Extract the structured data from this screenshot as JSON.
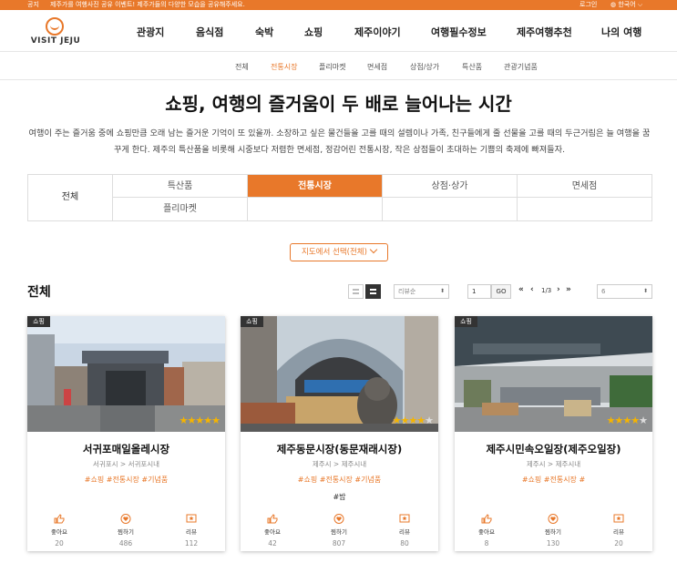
{
  "notice": {
    "label": "공지",
    "message": "제주가를 여행사진 공유 이벤트! 제주가들의 다양한 모습을 공유해주세요.",
    "login": "로그인",
    "language": "한국어"
  },
  "brand": {
    "logo_text": "VISIT JEJU",
    "accent": "#e8782a"
  },
  "gnb": [
    {
      "label": "관광지"
    },
    {
      "label": "음식점"
    },
    {
      "label": "숙박"
    },
    {
      "label": "쇼핑"
    },
    {
      "label": "제주이야기"
    },
    {
      "label": "여행필수정보"
    },
    {
      "label": "제주여행추천"
    },
    {
      "label": "나의 여행"
    }
  ],
  "subnav": [
    {
      "label": "전체"
    },
    {
      "label": "전통시장"
    },
    {
      "label": "플리마켓"
    },
    {
      "label": "면세점"
    },
    {
      "label": "상점/상가"
    },
    {
      "label": "특산품"
    },
    {
      "label": "관광기념품"
    }
  ],
  "hero": {
    "title": "쇼핑, 여행의 즐거움이 두 배로 늘어나는 시간",
    "description": "여행이 주는 즐거움 중에 쇼핑만큼 오래 남는 즐거운 기억이 또 있을까. 소장하고 싶은 물건들을 고를 때의 설렘이나 가족, 친구들에게 줄 선물을 고를 때의 두근거림은 늘 여행을 꿈꾸게 한다. 제주의 특산품을 비롯해 시중보다 저렴한 면세점, 정감어린 전통시장, 작은 상점들이 초대하는 기쁨의 축제에 빠져들자."
  },
  "category": {
    "all_label": "전체",
    "cells": [
      {
        "label": "특산품"
      },
      {
        "label": "전통시장"
      },
      {
        "label": "상점·상가"
      },
      {
        "label": "면세점"
      },
      {
        "label": "플리마켓"
      }
    ]
  },
  "map_select": {
    "label": "지도에서 선택(전체)"
  },
  "list": {
    "title": "전체",
    "sort_select": "리뷰순",
    "page_input": "1",
    "go_label": "GO",
    "first_icon": "«",
    "prev_icon": "‹",
    "page_info": "1/3",
    "next_icon": "›",
    "last_icon": "»",
    "per_page_select": "6"
  },
  "cards": [
    {
      "badge": "쇼핑",
      "name": "서귀포매일올레시장",
      "region": "서귀포시 > 서귀포시내",
      "tags": "#쇼핑 #전통시장 #기념품",
      "extra": "",
      "rating": 5,
      "stats": {
        "like_label": "좋아요",
        "like": "20",
        "bookmark_label": "찜하기",
        "bookmark": "486",
        "review_label": "리뷰",
        "review": "112"
      }
    },
    {
      "badge": "쇼핑",
      "name": "제주동문시장(동문재래시장)",
      "region": "제주시 > 제주시내",
      "tags": "#쇼핑 #전통시장 #기념품",
      "extra": "#밤",
      "rating": 4,
      "stats": {
        "like_label": "좋아요",
        "like": "42",
        "bookmark_label": "찜하기",
        "bookmark": "807",
        "review_label": "리뷰",
        "review": "80"
      }
    },
    {
      "badge": "쇼핑",
      "name": "제주시민속오일장(제주오일장)",
      "region": "제주시 > 제주시내",
      "tags": "#쇼핑 #전통시장 #",
      "extra": "",
      "rating": 4,
      "stats": {
        "like_label": "좋아요",
        "like": "8",
        "bookmark_label": "찜하기",
        "bookmark": "130",
        "review_label": "리뷰",
        "review": "20"
      }
    }
  ]
}
